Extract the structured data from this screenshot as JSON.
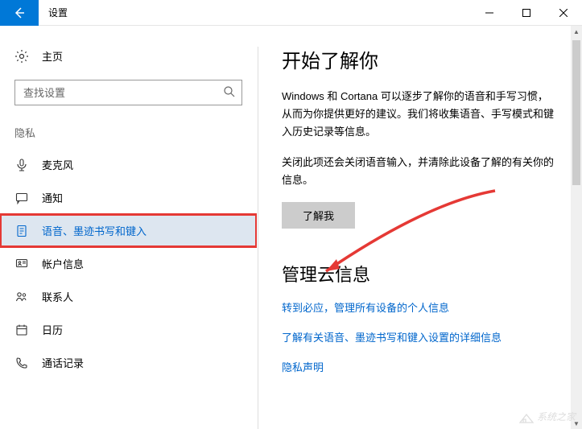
{
  "window": {
    "title": "设置"
  },
  "sidebar": {
    "home_label": "主页",
    "search_placeholder": "查找设置",
    "group_label": "隐私",
    "items": [
      {
        "icon": "mic-icon",
        "label": "麦克风"
      },
      {
        "icon": "chat-icon",
        "label": "通知"
      },
      {
        "icon": "speech-icon",
        "label": "语音、墨迹书写和键入"
      },
      {
        "icon": "account-icon",
        "label": "帐户信息"
      },
      {
        "icon": "contacts-icon",
        "label": "联系人"
      },
      {
        "icon": "calendar-icon",
        "label": "日历"
      },
      {
        "icon": "callhistory-icon",
        "label": "通话记录"
      }
    ]
  },
  "content": {
    "heading1": "开始了解你",
    "para1": "Windows 和 Cortana 可以逐步了解你的语音和手写习惯，从而为你提供更好的建议。我们将收集语音、手写模式和键入历史记录等信息。",
    "para2": "关闭此项还会关闭语音输入，并清除此设备了解的有关你的信息。",
    "button_label": "了解我",
    "heading2": "管理云信息",
    "link1": "转到必应，管理所有设备的个人信息",
    "link2": "了解有关语音、墨迹书写和键入设置的详细信息",
    "link3": "隐私声明"
  },
  "watermark": "系统之家"
}
